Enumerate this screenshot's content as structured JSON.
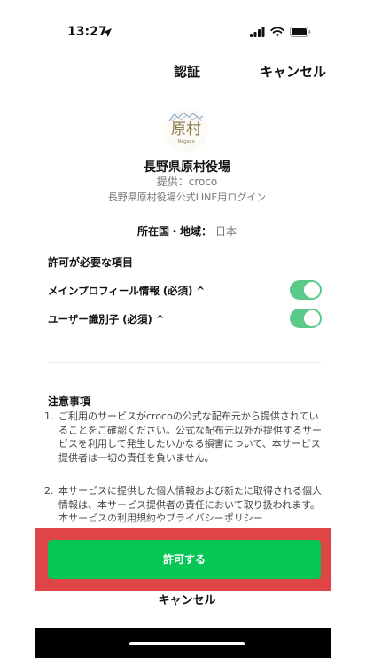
{
  "status_bar": {
    "time": "13:27",
    "icons": [
      "location-arrow-icon",
      "signal-icon",
      "wifi-icon",
      "battery-icon"
    ]
  },
  "header": {
    "title": "認証",
    "cancel_label": "キャンセル"
  },
  "app": {
    "logo_text": "原村",
    "logo_sub": "Nagano",
    "name": "長野県原村役場",
    "provider": "提供：croco",
    "description": "長野県原村役場公式LINE用ログイン"
  },
  "region": {
    "label": "所在国・地域：",
    "value": "日本"
  },
  "permissions": {
    "title": "許可が必要な項目",
    "items": [
      {
        "label": "メインプロフィール情報 (必須) ^",
        "enabled": true
      },
      {
        "label": "ユーザー識別子 (必須) ^",
        "enabled": true
      }
    ]
  },
  "notes": {
    "title": "注意事項",
    "items": [
      {
        "num": "1.",
        "text": "ご利用のサービスがcrocoの公式な配布元から提供されていることをご確認ください。公式な配布元以外が提供するサービスを利用して発生したいかなる損害について、本サービス提供者は一切の責任を負いません。"
      },
      {
        "num": "2.",
        "text": "本サービスに提供した個人情報および新たに取得される個人情報は、本サービス提供者の責任において取り扱われます。本サービスの利用規約やプライバシーポリシー"
      }
    ]
  },
  "actions": {
    "allow_label": "許可する",
    "cancel_label": "キャンセル"
  },
  "colors": {
    "accent": "#06c755",
    "toggle": "#5bc98a",
    "highlight": "#e04545"
  }
}
